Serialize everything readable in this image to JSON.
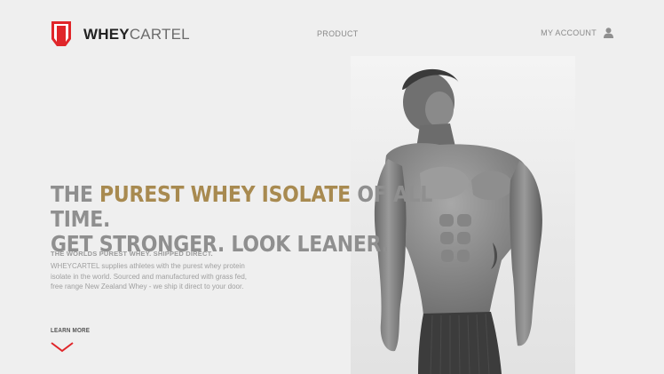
{
  "header": {
    "logo": {
      "bold": "WHEY",
      "light": "CARTEL"
    },
    "nav": {
      "product": "PRODUCT"
    },
    "account": {
      "label": "MY ACCOUNT"
    }
  },
  "hero": {
    "headline": {
      "prefix": "THE ",
      "highlight": "PUREST WHEY ISOLATE",
      "suffix": " OF ALL TIME.",
      "line2": "GET STRONGER. LOOK LEANER."
    },
    "subheading": "THE WORLDS PUREST WHEY. SHIPPED DIRECT.",
    "body": "WHEYCARTEL supplies athletes with the purest whey protein isolate in the world. Sourced and manufactured with grass fed, free range New Zealand Whey - we ship it direct to your door.",
    "cta": "LEARN MORE"
  },
  "colors": {
    "background": "#efefef",
    "brand_red": "#e0262a",
    "accent_gold": "#a88a50",
    "headline_gray": "#8f8f8f"
  },
  "icons": {
    "logo_mark": "shield-logo-icon",
    "account": "user-icon",
    "scroll": "chevron-down-icon"
  }
}
